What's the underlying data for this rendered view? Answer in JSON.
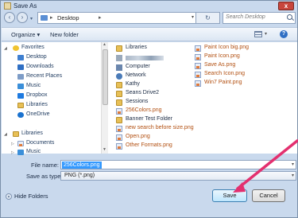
{
  "window": {
    "title": "Save As",
    "close_glyph": "x"
  },
  "address": {
    "location": "Desktop",
    "search_placeholder": "Search Desktop"
  },
  "toolbar": {
    "organize": "Organize ▾",
    "new_folder": "New folder"
  },
  "nav": {
    "favorites": "Favorites",
    "desktop": "Desktop",
    "downloads": "Downloads",
    "recent": "Recent Places",
    "music_fav": "Music",
    "dropbox": "Dropbox",
    "libraries_fav": "Libraries",
    "onedrive": "OneDrive",
    "libraries": "Libraries",
    "documents": "Documents",
    "music": "Music"
  },
  "files": {
    "col1": [
      "Libraries",
      "",
      "Computer",
      "Network",
      "Kathy",
      "Seans Drive2",
      "Sessions",
      "256Colors.png",
      "Banner Test Folder",
      "new search before size.png",
      "Open.png",
      "Other Formats.png"
    ],
    "col2": [
      "Paint Icon big.png",
      "Paint Icon.png",
      "Save As.png",
      "Search Icon.png",
      "Win7 Paint.png"
    ]
  },
  "form": {
    "file_name_label": "File name:",
    "file_name_value": "256Colors.png",
    "save_type_label": "Save as type:",
    "save_type_value": "PNG (*.png)"
  },
  "footer": {
    "hide_folders": "Hide Folders",
    "save": "Save",
    "cancel": "Cancel"
  },
  "colors": {
    "dialog": "#c9d9ed",
    "accent": "#3399ff",
    "annotation_arrow": "#e3306f"
  }
}
